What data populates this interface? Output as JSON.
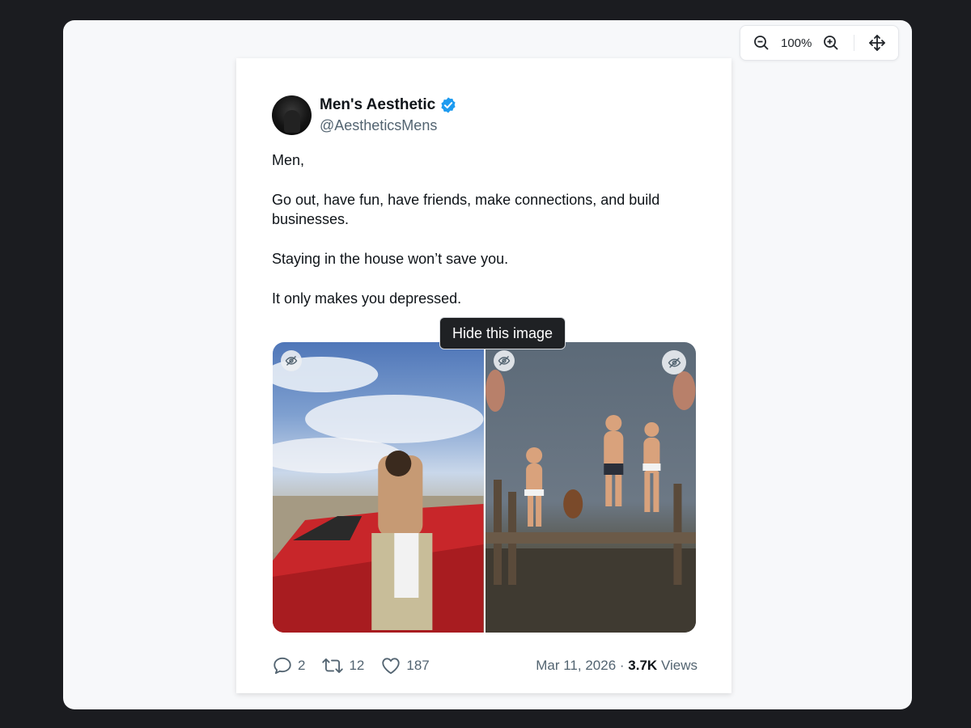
{
  "zoom": {
    "level": "100%",
    "zoom_out_icon": "zoom-out-icon",
    "zoom_in_icon": "zoom-in-icon",
    "move_icon": "move-icon"
  },
  "tweet": {
    "display_name": "Men's Aesthetic",
    "verified": true,
    "handle": "@AestheticsMens",
    "paragraphs": [
      "Men,",
      "Go out, have fun, have friends, make connections, and build businesses.",
      "Staying in the house won’t save you.",
      "It only makes you depressed."
    ],
    "media": {
      "tooltip": "Hide this image",
      "images": [
        {
          "subject": "man leaning on red convertible",
          "hide_icon": "eye-off-icon"
        },
        {
          "subject": "people jumping off pier",
          "hide_icon": "eye-off-icon"
        }
      ]
    },
    "stats": {
      "replies": "2",
      "reposts": "12",
      "likes": "187"
    },
    "date": "Mar 11, 2026",
    "separator": "·",
    "views_count": "3.7K",
    "views_label": "Views"
  },
  "colors": {
    "verified_blue": "#1d9bf0",
    "text_primary": "#0f1419",
    "text_secondary": "#536471"
  }
}
